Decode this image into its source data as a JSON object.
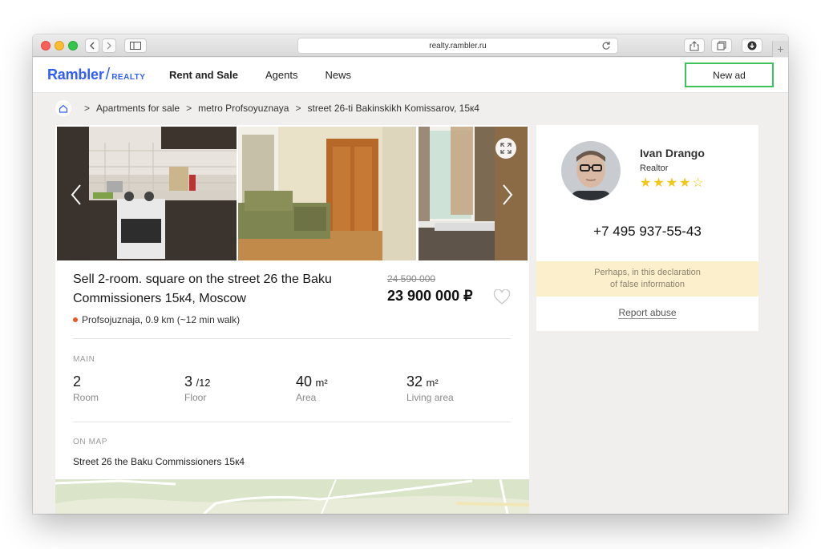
{
  "browser": {
    "url": "realty.rambler.ru"
  },
  "header": {
    "brand": "Rambler",
    "brand_sub": "REALTY",
    "nav": [
      {
        "label": "Rent and Sale",
        "active": true
      },
      {
        "label": "Agents",
        "active": false
      },
      {
        "label": "News",
        "active": false
      }
    ],
    "new_ad_label": "New ad",
    "brand_color": "#315efb",
    "new_ad_border_color": "#3dc35a"
  },
  "breadcrumb": {
    "items": [
      "Apartments for sale",
      "metro Profsoyuznaya",
      "street 26-ti Bakinskikh Komissarov, 15к4"
    ]
  },
  "listing": {
    "title": "Sell 2-room. square on the street 26 the Baku Commissioners 15к4, Moscow",
    "old_price": "24 590 000",
    "price": "23 900 000 ₽",
    "metro": "Profsojuznaja, 0.9 km (~12 min walk)",
    "metro_color": "#f0571c",
    "main_label": "MAIN",
    "stats": [
      {
        "value": "2",
        "unit": "",
        "label": "Room"
      },
      {
        "value": "3",
        "unit": "/12",
        "label": "Floor"
      },
      {
        "value": "40",
        "unit": "m²",
        "label": "Area"
      },
      {
        "value": "32",
        "unit": "m²",
        "label": "Living area"
      }
    ],
    "map_label": "ON MAP",
    "address": "Street 26 the Baku Commissioners 15к4"
  },
  "agent": {
    "name": "Ivan Drango",
    "role": "Realtor",
    "rating": 4,
    "rating_max": 5,
    "phone": "+7 495 937-55-43",
    "warning_line1": "Perhaps, in this declaration",
    "warning_line2": "of false information",
    "report_label": "Report abuse",
    "star_color": "#f5c518"
  }
}
